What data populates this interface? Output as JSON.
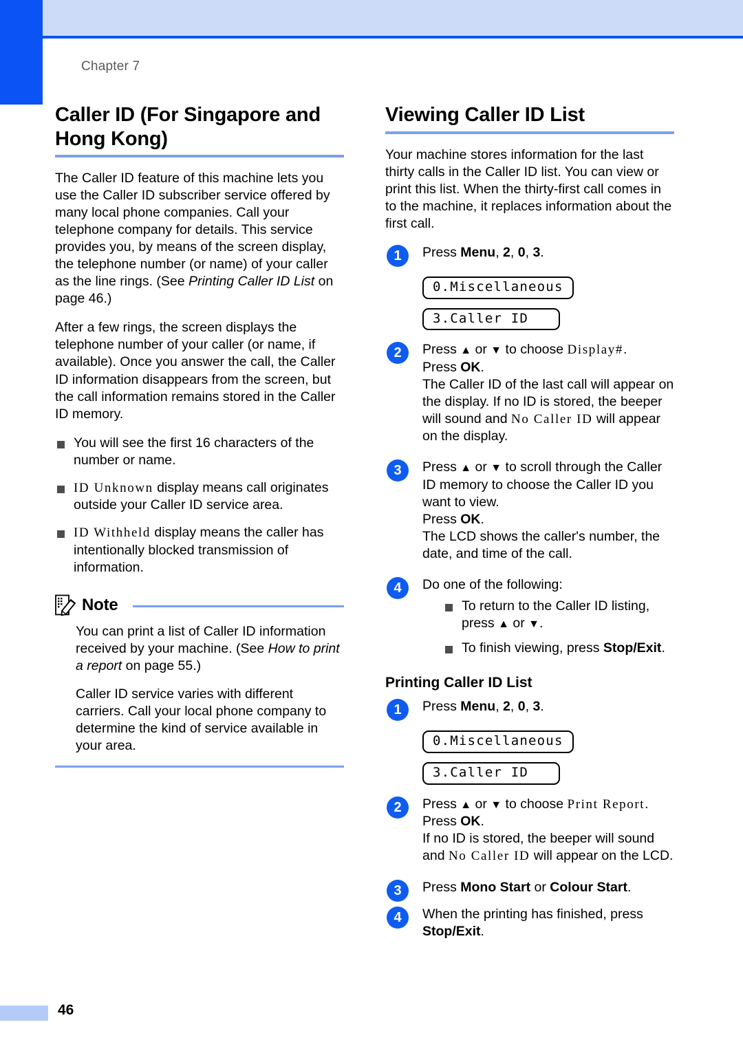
{
  "page": {
    "chapter_label": "Chapter 7",
    "page_number": "46",
    "accent_blue": "#0b53f5",
    "rule_blue": "#7ba0ee",
    "header_band": "#ccdbf7"
  },
  "left_column": {
    "title": "Caller ID (For Singapore and Hong Kong)",
    "paragraph_1_a": "The Caller ID feature of this machine lets you use the Caller ID subscriber service offered by many local phone companies. Call your telephone company for details. This service provides you, by means of the screen display, the telephone number (or name) of your caller as the line rings. (See ",
    "paragraph_1_italic": "Printing Caller ID List",
    "paragraph_1_b": " on page 46.)",
    "paragraph_2": "After a few rings, the screen displays the telephone number of your caller (or name, if available). Once you answer the call, the Caller ID information disappears from the screen, but the call information remains stored in the Caller ID memory.",
    "bullets": [
      {
        "lcd": "",
        "text": "You will see the first 16 characters of the number or name."
      },
      {
        "lcd": "ID Unknown",
        "text": " display means call originates outside your Caller ID service area."
      },
      {
        "lcd": "ID Withheld",
        "text": " display means the caller has intentionally blocked transmission of information."
      }
    ],
    "note": {
      "label": "Note",
      "paragraph_1_a": "You can print a list of Caller ID information received by your machine. (See ",
      "paragraph_1_italic": "How to print a report",
      "paragraph_1_b": " on page 55.)",
      "paragraph_2": "Caller ID service varies with different carriers. Call your local phone company to determine the kind of service available in your area."
    }
  },
  "right_column": {
    "title": "Viewing Caller ID List",
    "intro": "Your machine stores information for the last thirty calls in the Caller ID list. You can view or print this list. When the thirty-first call comes in to the machine, it replaces information about the first call.",
    "viewing_steps": {
      "step1": {
        "number": "1",
        "press_word": "Press ",
        "menu_key": "Menu",
        "keys_tail": ", 2, 0, 3.",
        "key_2": "2",
        "key_0": "0",
        "key_3": "3",
        "lcd_line_1": "0.Miscellaneous",
        "lcd_line_2": "3.Caller ID"
      },
      "step2": {
        "number": "2",
        "line1_a": "Press ",
        "line1_b": " or ",
        "line1_c": " to choose ",
        "lcd_choice": "Display#",
        "line1_d": ".",
        "press_ok_a": "Press ",
        "ok_key": "OK",
        "press_ok_b": ".",
        "body_a": "The Caller ID of the last call will appear on the display. If no ID is stored, the beeper will sound and ",
        "lcd_inline": "No Caller ID",
        "body_b": " will appear on the display."
      },
      "step3": {
        "number": "3",
        "body_a": "Press ",
        "body_b": " or ",
        "body_c": " to scroll through the Caller ID memory to choose the Caller ID you want to view.",
        "press_ok_a": "Press ",
        "ok_key": "OK",
        "press_ok_b": ".",
        "body_d": "The LCD shows the caller's number, the date, and time of the call."
      },
      "step4": {
        "number": "4",
        "intro": "Do one of the following:",
        "bullets": [
          {
            "text_a": "To return to the Caller ID listing, press ",
            "text_b": " or ",
            "text_c": "."
          },
          {
            "text_a": "To finish viewing, press ",
            "bold": "Stop/Exit",
            "text_c": "."
          }
        ]
      }
    },
    "printing_section": {
      "title": "Printing Caller ID List",
      "step1": {
        "number": "1",
        "press_word": "Press ",
        "menu_key": "Menu",
        "key_2": "2",
        "key_0": "0",
        "key_3": "3",
        "lcd_line_1": "0.Miscellaneous",
        "lcd_line_2": "3.Caller ID"
      },
      "step2": {
        "number": "2",
        "line1_a": "Press ",
        "line1_b": " or ",
        "line1_c": " to choose ",
        "lcd_choice": "Print Report",
        "line1_d": ".",
        "press_ok_a": "Press ",
        "ok_key": "OK",
        "press_ok_b": ".",
        "body_a": "If no ID is stored, the beeper will sound and ",
        "lcd_inline": "No Caller ID",
        "body_b": " will appear on the LCD."
      },
      "step3": {
        "number": "3",
        "text_a": "Press ",
        "bold_1": "Mono Start",
        "text_b": " or ",
        "bold_2": "Colour Start",
        "text_c": "."
      },
      "step4": {
        "number": "4",
        "text_a": "When the printing has finished, press ",
        "bold_1": "Stop/Exit",
        "text_c": "."
      }
    }
  },
  "glyphs": {
    "up_arrow": "▲",
    "down_arrow": "▼"
  }
}
